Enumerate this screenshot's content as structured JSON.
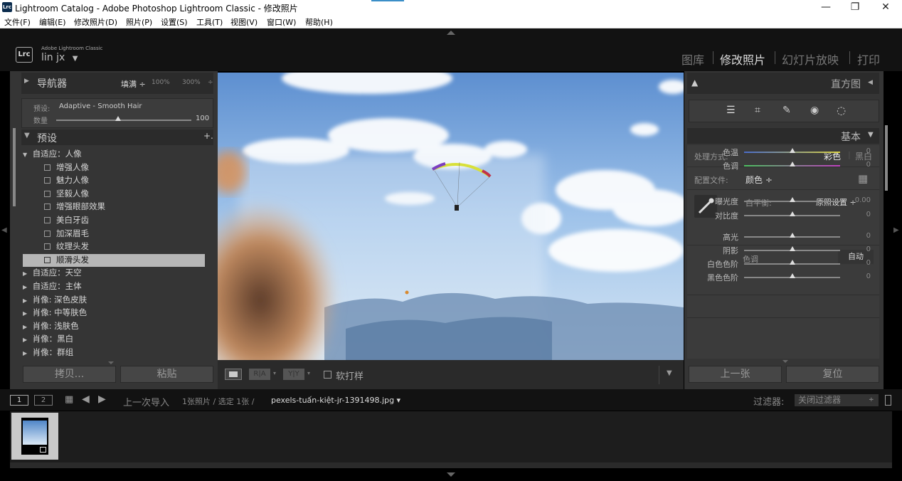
{
  "window": {
    "app_icon": "Lrc",
    "title": "Lightroom Catalog - Adobe Photoshop Lightroom Classic - 修改照片",
    "minimize": "—",
    "restore": "❐",
    "close": "✕"
  },
  "menu": [
    "文件(F)",
    "编辑(E)",
    "修改照片(D)",
    "照片(P)",
    "设置(S)",
    "工具(T)",
    "视图(V)",
    "窗口(W)",
    "帮助(H)"
  ],
  "identity": {
    "logo": "Lrc",
    "brand": "Adobe Lightroom Classic",
    "user": "lin jx",
    "caret": "▼"
  },
  "modules": [
    "图库",
    "修改照片",
    "幻灯片放映",
    "打印"
  ],
  "left_panel": {
    "navigator": {
      "title": "导航器",
      "fit": "填满 ÷",
      "z1": "100%",
      "z2": "300%",
      "z3": "÷"
    },
    "preset_label": "预设:",
    "preset_value": "Adaptive - Smooth Hair",
    "amount_label": "数量",
    "amount_value": "100",
    "presets_title": "预设",
    "add": "+.",
    "tree": [
      {
        "label": "自适应：人像",
        "type": "group-open"
      },
      {
        "label": "增强人像",
        "type": "item"
      },
      {
        "label": "魅力人像",
        "type": "item"
      },
      {
        "label": "坚毅人像",
        "type": "item"
      },
      {
        "label": "增强眼部效果",
        "type": "item"
      },
      {
        "label": "美白牙齿",
        "type": "item"
      },
      {
        "label": "加深眉毛",
        "type": "item"
      },
      {
        "label": "纹理头发",
        "type": "item"
      },
      {
        "label": "顺滑头发",
        "type": "selected"
      },
      {
        "label": "自适应：天空",
        "type": "group"
      },
      {
        "label": "自适应：主体",
        "type": "group"
      },
      {
        "label": "肖像: 深色皮肤",
        "type": "group"
      },
      {
        "label": "肖像: 中等肤色",
        "type": "group"
      },
      {
        "label": "肖像: 浅肤色",
        "type": "group"
      },
      {
        "label": "肖像：黑白",
        "type": "group"
      },
      {
        "label": "肖像：群组",
        "type": "group"
      }
    ],
    "copy": "拷贝...",
    "paste": "粘贴"
  },
  "toolbar": {
    "softproof": "软打样",
    "ra": "R|A",
    "yy": "Y|Y"
  },
  "right_panel": {
    "histogram": "直方图",
    "basic": "基本",
    "process_label": "处理方式:",
    "color": "彩色",
    "bw": "黑白",
    "profile_label": "配置文件:",
    "profile_value": "颜色 ÷",
    "wb_label": "白平衡:",
    "wb_value": "原照设置 ÷",
    "tone_header": "色调",
    "auto": "自动",
    "sliders": [
      {
        "label": "色温",
        "value": "0",
        "pos": 0.5
      },
      {
        "label": "色调",
        "value": "0",
        "pos": 0.5
      },
      {
        "label": "曝光度",
        "value": "0.00",
        "pos": 0.5
      },
      {
        "label": "对比度",
        "value": "0",
        "pos": 0.5
      },
      {
        "label": "高光",
        "value": "0",
        "pos": 0.5
      },
      {
        "label": "阴影",
        "value": "0",
        "pos": 0.5
      },
      {
        "label": "白色色阶",
        "value": "0",
        "pos": 0.5
      },
      {
        "label": "黑色色阶",
        "value": "0",
        "pos": 0.5
      }
    ],
    "prev": "上一张",
    "reset": "复位"
  },
  "filmstrip": {
    "v1": "1",
    "v2": "2",
    "source": "上一次导入",
    "count": "1张照片 / 选定 1张 /",
    "file": "pexels-tuấn-kiệt-jr-1391498.jpg ▾",
    "filter_label": "过滤器:",
    "filter_value": "关闭过滤器"
  }
}
